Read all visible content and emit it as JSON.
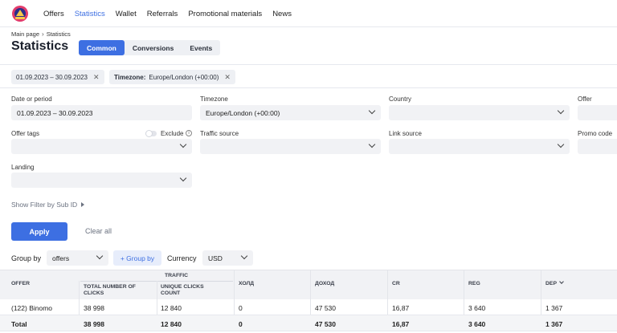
{
  "nav": {
    "items": [
      {
        "label": "Offers",
        "active": false
      },
      {
        "label": "Statistics",
        "active": true
      },
      {
        "label": "Wallet",
        "active": false
      },
      {
        "label": "Referrals",
        "active": false
      },
      {
        "label": "Promotional materials",
        "active": false
      },
      {
        "label": "News",
        "active": false
      }
    ]
  },
  "breadcrumb": {
    "home": "Main page",
    "current": "Statistics"
  },
  "page": {
    "title": "Statistics"
  },
  "tabs": [
    {
      "label": "Common",
      "active": true
    },
    {
      "label": "Conversions",
      "active": false
    },
    {
      "label": "Events",
      "active": false
    }
  ],
  "chips": {
    "date": "01.09.2023 – 30.09.2023",
    "timezone_key": "Timezone:",
    "timezone_value": "Europe/London (+00:00)"
  },
  "filters": {
    "date_label": "Date or period",
    "date_value": "01.09.2023 – 30.09.2023",
    "timezone_label": "Timezone",
    "timezone_value": "Europe/London (+00:00)",
    "country_label": "Country",
    "offer_label": "Offer",
    "offer_tags_label": "Offer tags",
    "exclude_label": "Exclude",
    "traffic_source_label": "Traffic source",
    "link_source_label": "Link source",
    "promo_code_label": "Promo code",
    "landing_label": "Landing",
    "subid_link": "Show Filter by Sub ID"
  },
  "actions": {
    "apply": "Apply",
    "clear": "Clear all"
  },
  "grouping": {
    "group_by_label": "Group by",
    "group_by_value": "offers",
    "add_group": "+ Group by",
    "currency_label": "Currency",
    "currency_value": "USD"
  },
  "table": {
    "group_header": "TRAFFIC",
    "columns": [
      "OFFER",
      "TOTAL NUMBER OF CLICKS",
      "UNIQUE CLICKS COUNT",
      "ХОЛД",
      "ДОХОД",
      "CR",
      "REG",
      "DEP"
    ],
    "rows": [
      [
        "(122) Binomo",
        "38 998",
        "12 840",
        "0",
        "47 530",
        "16,87",
        "3 640",
        "1 367"
      ]
    ],
    "total": [
      "Total",
      "38 998",
      "12 840",
      "0",
      "47 530",
      "16,87",
      "3 640",
      "1 367"
    ]
  },
  "colors": {
    "accent": "#3d6fe2"
  }
}
